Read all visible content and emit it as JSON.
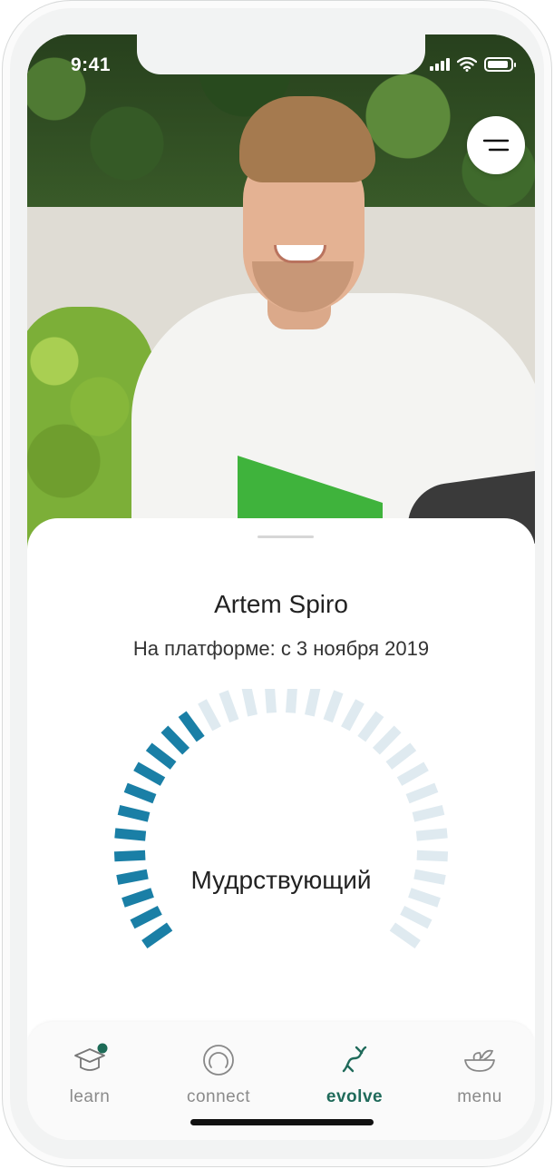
{
  "status_bar": {
    "time": "9:41"
  },
  "profile": {
    "name": "Artem Spiro",
    "since": "На платформе: с 3 ноября 2019"
  },
  "progress": {
    "level_label": "Мудрствующий",
    "segments_total": 32,
    "segments_filled": 12,
    "filled_color": "#1a7fa6",
    "empty_color": "#dfeaf0"
  },
  "menu_button": {
    "icon": "hamburger-icon"
  },
  "tabs": [
    {
      "label": "learn",
      "icon": "graduation-cap-icon",
      "badge": true,
      "active": false
    },
    {
      "label": "connect",
      "icon": "concentric-circles-icon",
      "badge": false,
      "active": false
    },
    {
      "label": "evolve",
      "icon": "dna-helix-icon",
      "badge": false,
      "active": true
    },
    {
      "label": "menu",
      "icon": "bowl-icon",
      "badge": false,
      "active": false
    }
  ],
  "colors": {
    "accent": "#1f6a5a",
    "badge": "#1d6b57"
  }
}
